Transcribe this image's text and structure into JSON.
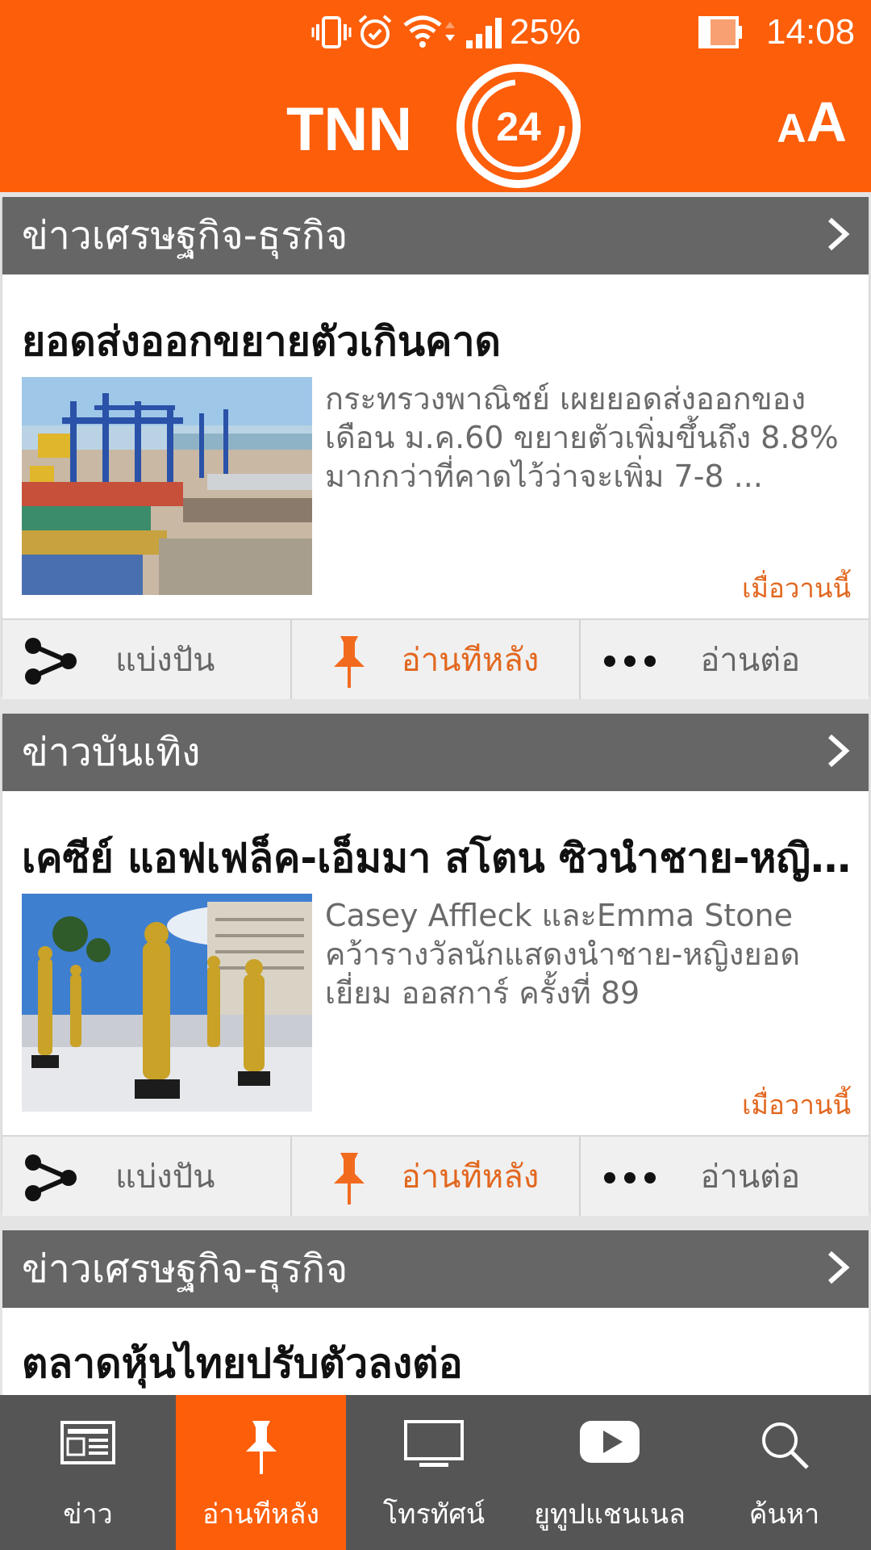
{
  "status_bar": {
    "battery_percent": "25%",
    "time": "14:08",
    "battery_level": 0.25
  },
  "header": {
    "logo_text": "TNN",
    "logo_number": "24",
    "font_size_small": "A",
    "font_size_big": "A"
  },
  "cards": [
    {
      "category": "ข่าวเศรษฐกิจ-ธุรกิจ",
      "title": "ยอดส่งออกขยายตัวเกินคาด",
      "summary": "กระทรวงพาณิชย์ เผยยอดส่งออกของเดือน ม.ค.60 ขยายตัวเพิ่มขึ้นถึง 8.8% มากกว่าที่คาดไว้ว่าจะเพิ่ม 7-8 ...",
      "time": "เมื่อวานนี้",
      "image": "container-port-photo"
    },
    {
      "category": "ข่าวบันเทิง",
      "title": "เคซีย์ แอฟเฟล็ค-เอ็มมา สโตน ซิวนำชาย-หญิงยอดเยี่ยม",
      "summary": "Casey Affleck และEmma Stone คว้ารางวัลนักแสดงนำชาย-หญิงยอดเยี่ยม ออสการ์ ครั้งที่ 89",
      "time": "เมื่อวานนี้",
      "image": "oscar-statues-photo"
    },
    {
      "category": "ข่าวเศรษฐกิจ-ธุรกิจ",
      "title": "ตลาดหุ้นไทยปรับตัวลงต่อ"
    }
  ],
  "actions": {
    "share": "แบ่งปัน",
    "read_later": "อ่านทีหลัง",
    "read_more": "อ่านต่อ"
  },
  "bottom_nav": {
    "news": "ข่าว",
    "read_later": "อ่านทีหลัง",
    "tv": "โทรทัศน์",
    "youtube": "ยูทูปแชนเนล",
    "search": "ค้นหา"
  },
  "colors": {
    "brand_orange": "#fd5e0a",
    "category_bar": "#666666",
    "time_text": "#e2671f",
    "nav_bg": "#555555"
  }
}
